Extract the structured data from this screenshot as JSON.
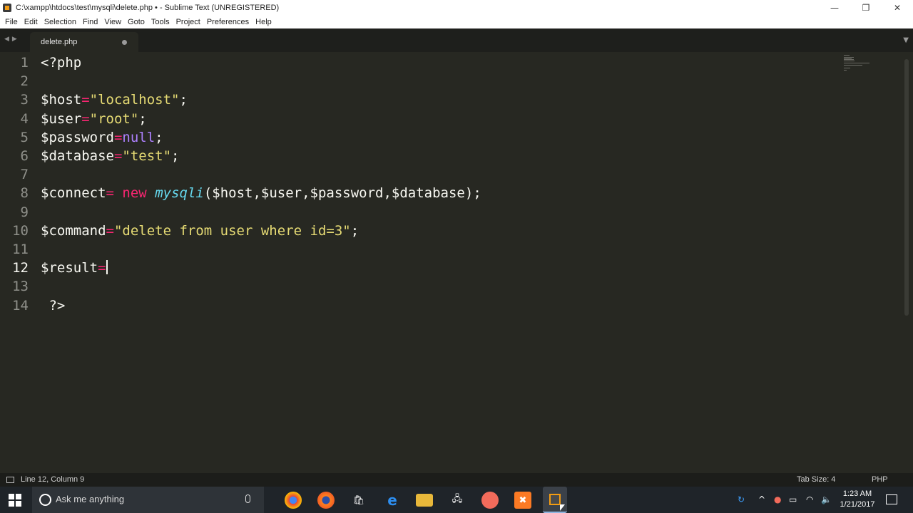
{
  "window": {
    "title": "C:\\xampp\\htdocs\\test\\mysqli\\delete.php • - Sublime Text (UNREGISTERED)",
    "minimize": "—",
    "restore": "❐",
    "close": "✕"
  },
  "menu": [
    "File",
    "Edit",
    "Selection",
    "Find",
    "View",
    "Goto",
    "Tools",
    "Project",
    "Preferences",
    "Help"
  ],
  "tabs": [
    {
      "label": "delete.php",
      "modified": true
    }
  ],
  "editor": {
    "line_numbers": [
      "1",
      "2",
      "3",
      "4",
      "5",
      "6",
      "7",
      "8",
      "9",
      "10",
      "11",
      "12",
      "13",
      "14"
    ],
    "current_line": 12,
    "lines": [
      [
        {
          "t": "<?php",
          "c": "c-punc"
        }
      ],
      [],
      [
        {
          "t": "$host",
          "c": "c-var"
        },
        {
          "t": "=",
          "c": "c-op"
        },
        {
          "t": "\"localhost\"",
          "c": "c-str"
        },
        {
          "t": ";",
          "c": "c-punc"
        }
      ],
      [
        {
          "t": "$user",
          "c": "c-var"
        },
        {
          "t": "=",
          "c": "c-op"
        },
        {
          "t": "\"root\"",
          "c": "c-str"
        },
        {
          "t": ";",
          "c": "c-punc"
        }
      ],
      [
        {
          "t": "$password",
          "c": "c-var"
        },
        {
          "t": "=",
          "c": "c-op"
        },
        {
          "t": "null",
          "c": "c-null"
        },
        {
          "t": ";",
          "c": "c-punc"
        }
      ],
      [
        {
          "t": "$database",
          "c": "c-var"
        },
        {
          "t": "=",
          "c": "c-op"
        },
        {
          "t": "\"test\"",
          "c": "c-str"
        },
        {
          "t": ";",
          "c": "c-punc"
        }
      ],
      [],
      [
        {
          "t": "$connect",
          "c": "c-var"
        },
        {
          "t": "= ",
          "c": "c-op"
        },
        {
          "t": "new",
          "c": "c-kw"
        },
        {
          "t": " ",
          "c": "c-punc"
        },
        {
          "t": "mysqli",
          "c": "c-cls"
        },
        {
          "t": "($host,$user,$password,$database);",
          "c": "c-punc"
        }
      ],
      [],
      [
        {
          "t": "$command",
          "c": "c-var"
        },
        {
          "t": "=",
          "c": "c-op"
        },
        {
          "t": "\"delete from user where id=3\"",
          "c": "c-str"
        },
        {
          "t": ";",
          "c": "c-punc"
        }
      ],
      [],
      [
        {
          "t": "$result",
          "c": "c-var"
        },
        {
          "t": "=",
          "c": "c-op"
        }
      ],
      [],
      [
        {
          "t": " ?>",
          "c": "c-punc"
        }
      ]
    ]
  },
  "status": {
    "position": "Line 12, Column 9",
    "tab_size": "Tab Size: 4",
    "syntax": "PHP"
  },
  "taskbar": {
    "search_placeholder": "Ask me anything",
    "apps": [
      "chrome-icon",
      "firefox-icon",
      "store-icon",
      "edge-icon",
      "explorer-icon",
      "network-app-icon",
      "app-icon",
      "xampp-icon",
      "sublime-icon"
    ],
    "clock_time": "1:23 AM",
    "clock_date": "1/21/2017"
  },
  "colors": {
    "background": "#272822",
    "keyword": "#f92672",
    "string": "#e6db74",
    "constant": "#ae81ff",
    "class": "#66d9ef"
  }
}
